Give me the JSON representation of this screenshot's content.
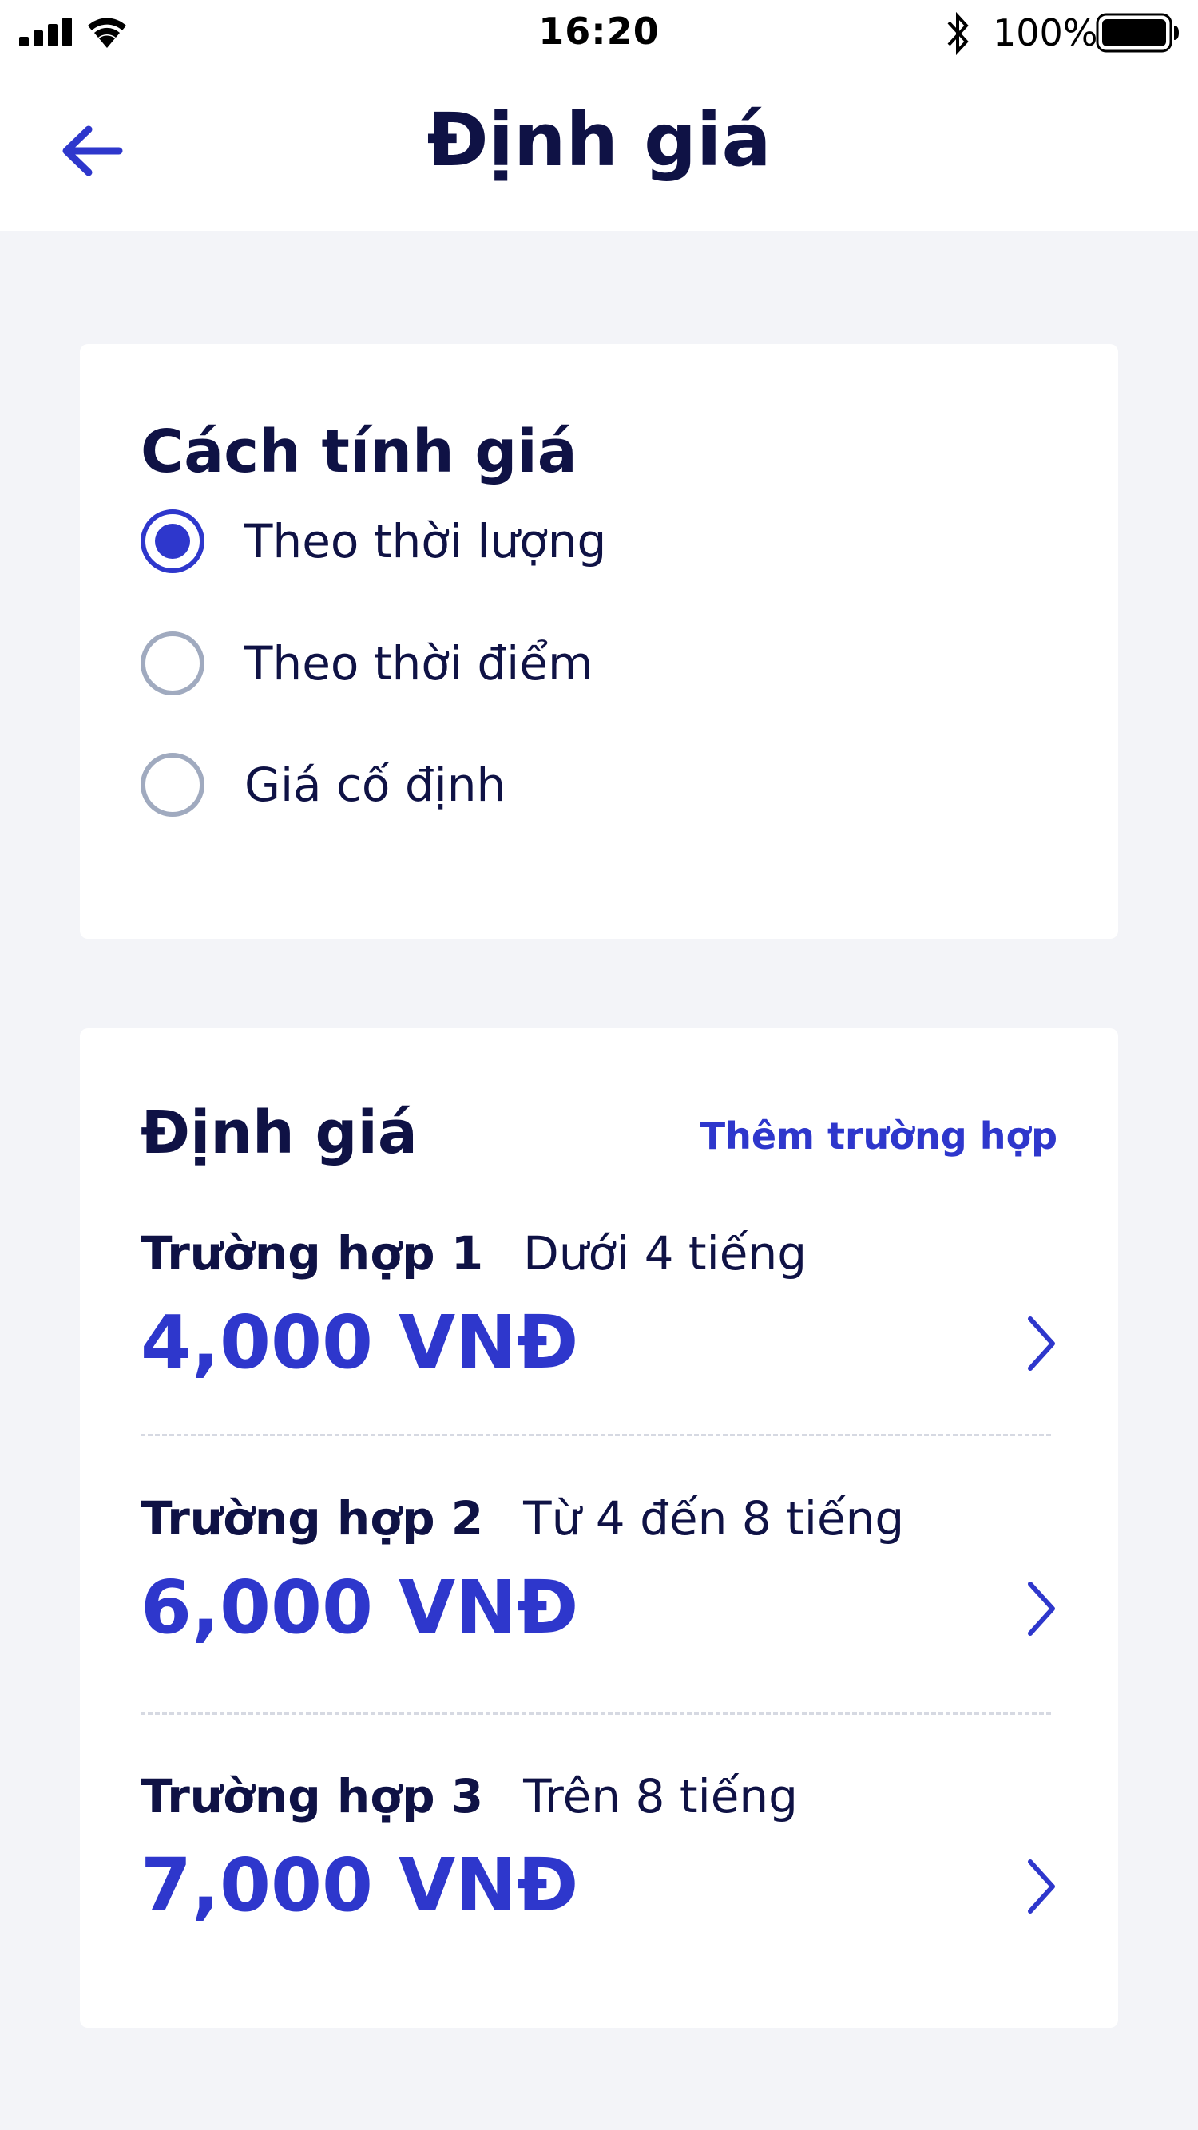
{
  "status_bar": {
    "time": "16:20",
    "battery": "100%",
    "icons": [
      "signal-icon",
      "wifi-icon",
      "bluetooth-icon",
      "battery-icon"
    ]
  },
  "nav": {
    "title": "Định giá",
    "back_icon": "arrow-left-icon"
  },
  "pricing_method": {
    "heading": "Cách tính giá",
    "options": [
      {
        "label": "Theo thời lượng",
        "selected": true
      },
      {
        "label": "Theo thời điểm",
        "selected": false
      },
      {
        "label": "Giá cố định",
        "selected": false
      }
    ]
  },
  "pricing": {
    "heading": "Định giá",
    "add_case_label": "Thêm trường hợp",
    "cases": [
      {
        "name": "Trường hợp 1",
        "description": "Dưới 4 tiếng",
        "price": "4,000 VNĐ"
      },
      {
        "name": "Trường hợp 2",
        "description": "Từ 4 đến 8 tiếng",
        "price": "6,000 VNĐ"
      },
      {
        "name": "Trường hợp 3",
        "description": "Trên 8 tiếng",
        "price": "7,000 VNĐ"
      }
    ]
  },
  "colors": {
    "accent": "#2E37CC",
    "text_primary": "#0F1245",
    "background": "#F3F4F8",
    "radio_unselected": "#A0AABF"
  }
}
